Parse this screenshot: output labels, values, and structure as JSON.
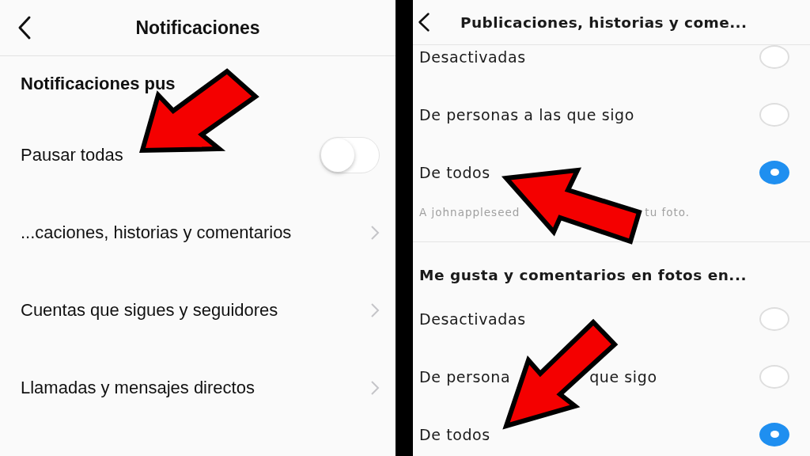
{
  "left": {
    "title": "Notificaciones",
    "section": "Notificaciones pus",
    "rows": [
      {
        "kind": "toggle",
        "label": "Pausar todas",
        "on": false
      },
      {
        "kind": "link",
        "label": "...caciones, historias y comentarios"
      },
      {
        "kind": "link",
        "label": "Cuentas que sigues y seguidores"
      },
      {
        "kind": "link",
        "label": "Llamadas y mensajes directos"
      }
    ]
  },
  "right": {
    "title": "Publicaciones, historias y come...",
    "groups": [
      {
        "options": [
          {
            "label_parts": [
              "Desactivadas"
            ],
            "selected": false
          },
          {
            "label_parts": [
              "De personas a las que sigo"
            ],
            "selected": false
          },
          {
            "label_parts": [
              "De todos"
            ],
            "selected": true
          }
        ],
        "note_parts": [
          "A johnappleseed",
          "tu foto."
        ]
      },
      {
        "heading": "Me gusta y comentarios en fotos en...",
        "options": [
          {
            "label_parts": [
              "Desactivadas"
            ],
            "selected": false
          },
          {
            "label_parts": [
              "De persona",
              "que sigo"
            ],
            "selected": false
          },
          {
            "label_parts": [
              "De todos"
            ],
            "selected": true
          }
        ]
      }
    ]
  }
}
